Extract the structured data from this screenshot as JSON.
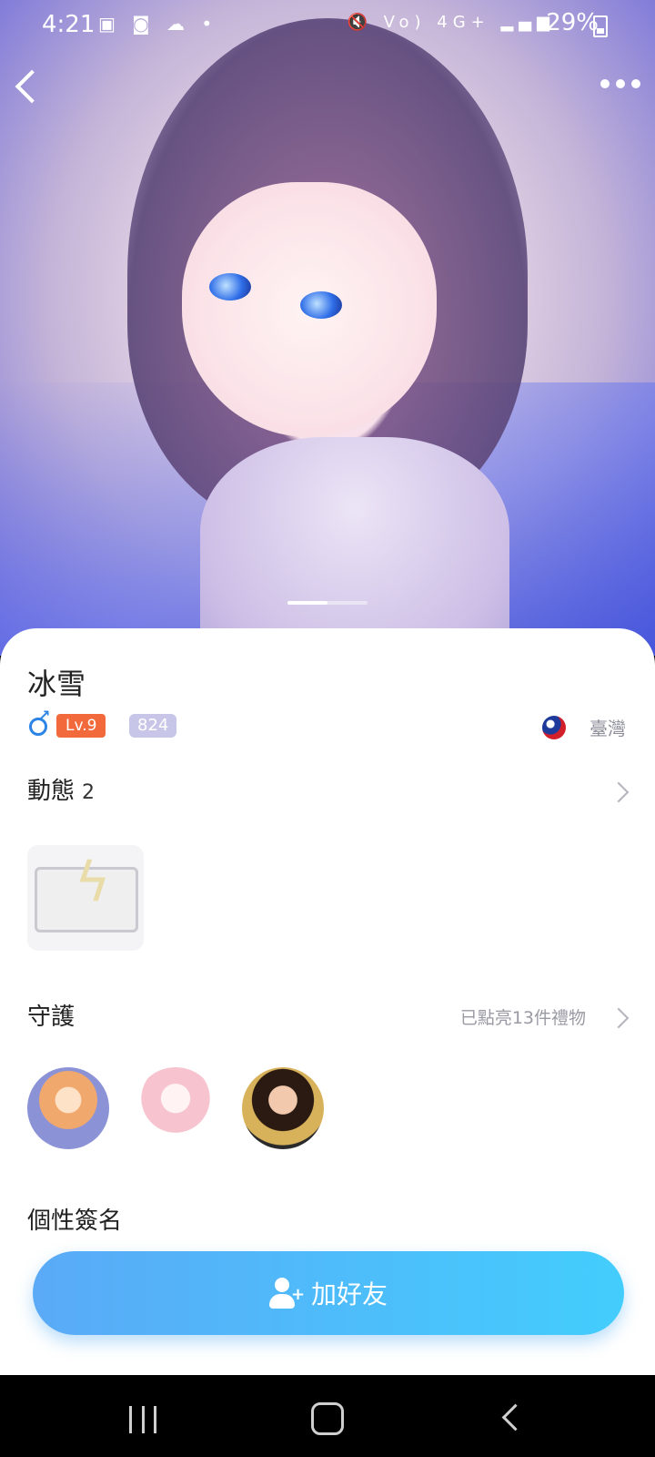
{
  "status_bar": {
    "time": "4:21",
    "left_icons": "▣ ◙ ☁ •",
    "right_signal": "🔇 Vo) 4G+ ▂▄▆",
    "battery": "29%"
  },
  "profile": {
    "name": "冰雪",
    "level": "Lv.9",
    "number_badge": "824",
    "region": "臺灣"
  },
  "moments": {
    "title": "動態",
    "count": "2"
  },
  "guard": {
    "title": "守護",
    "subtitle": "已點亮13件禮物"
  },
  "signature": {
    "title": "個性簽名"
  },
  "actions": {
    "add_friend": "加好友"
  },
  "colors": {
    "accent_start": "#5aaaf7",
    "accent_end": "#43cdfd",
    "level_badge": "#f26a3c"
  }
}
